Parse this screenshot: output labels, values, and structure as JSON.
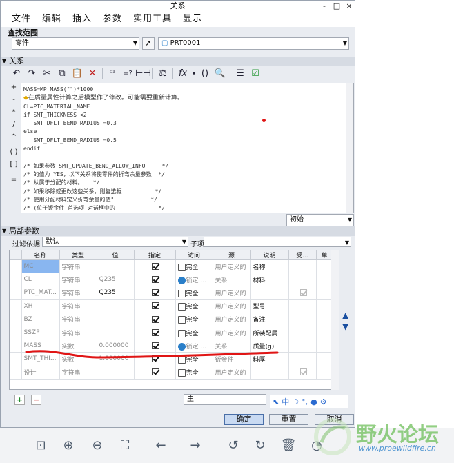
{
  "window": {
    "title": "关系",
    "controls": [
      "-",
      "□",
      "×"
    ]
  },
  "menu": [
    "文件",
    "编辑",
    "插入",
    "参数",
    "实用工具",
    "显示"
  ],
  "scope": {
    "label": "查找范围",
    "type_value": "零件",
    "model_value": "PRT0001"
  },
  "relations": {
    "header": "关系",
    "left_buttons": [
      "+",
      "-",
      "*",
      "/",
      "^",
      "( )",
      "[ ]",
      "="
    ],
    "code_lines": [
      "MASS=MP_MASS(\"\")*1000",
      "在质量属性计算之后模型作了修改。可能需要重新计算。",
      "CL=PTC_MATERIAL_NAME",
      "if SMT_THICKNESS <2",
      "   SMT_DFLT_BEND_RADIUS =0.3",
      "else",
      "   SMT_DFLT_BEND_RADIUS =0.5",
      "endif",
      "",
      "/* 如果参数 SMT_UPDATE_BEND_ALLOW_INFO     */",
      "/* 的值为 YES，以下关系将使零件的折弯余量参数  */",
      "/* 从属于分配的材料。   */",
      "/* 如果移除或更改这些关系，则复选框          */",
      "/* 使用分配材料定义折弯余量的值\"           */",
      "/* (位于钣金件 首选项 对话框中的             */"
    ],
    "units_value": "初始"
  },
  "local_params": {
    "header": "局部参数",
    "filter_label": "过滤依据",
    "filter_value": "默认",
    "subitem_label": "子项",
    "columns": [
      "名称",
      "类型",
      "值",
      "指定",
      "访问",
      "源",
      "说明",
      "受...",
      "单"
    ],
    "rows": [
      {
        "name": "MC",
        "type": "字符串",
        "value": "",
        "designated": true,
        "access": "完全",
        "source": "用户定义的",
        "desc": "名称",
        "restricted": false
      },
      {
        "name": "CL",
        "type": "字符串",
        "value": "Q235",
        "designated": true,
        "access": "锁定 ...",
        "source": "关系",
        "desc": "材料",
        "restricted": false
      },
      {
        "name": "PTC_MAT...",
        "type": "字符串",
        "value": "Q235",
        "designated": true,
        "access": "完全",
        "source": "用户定义的",
        "desc": "",
        "restricted": true
      },
      {
        "name": "XH",
        "type": "字符串",
        "value": "",
        "designated": true,
        "access": "完全",
        "source": "用户定义的",
        "desc": "型号",
        "restricted": false
      },
      {
        "name": "BZ",
        "type": "字符串",
        "value": "",
        "designated": true,
        "access": "完全",
        "source": "用户定义的",
        "desc": "备注",
        "restricted": false
      },
      {
        "name": "SSZP",
        "type": "字符串",
        "value": "",
        "designated": true,
        "access": "完全",
        "source": "用户定义的",
        "desc": "所装配属",
        "restricted": false
      },
      {
        "name": "MASS",
        "type": "实数",
        "value": "0.000000",
        "designated": true,
        "access": "锁定 ...",
        "source": "关系",
        "desc": "质量(g)",
        "restricted": false
      },
      {
        "name": "SMT_THI...",
        "type": "实数",
        "value": "1.000000",
        "designated": true,
        "access": "完全",
        "source": "钣金件",
        "desc": "料厚",
        "restricted": false
      },
      {
        "name": "设计",
        "type": "字符串",
        "value": "",
        "designated": true,
        "access": "完全",
        "source": "用户定义的",
        "desc": "",
        "restricted": true
      }
    ],
    "main_field": "主"
  },
  "buttons": {
    "ok": "确定",
    "reset": "重置",
    "cancel": "取消"
  },
  "watermark": {
    "text": "野火论坛",
    "url": "www.proewildfire.cn"
  },
  "colors": {
    "accent": "#89b6f0",
    "annotation": "#e01515",
    "watermark": "#6fbf5b"
  }
}
